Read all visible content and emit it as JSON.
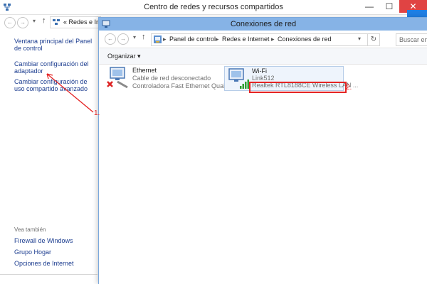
{
  "back_window": {
    "title": "Centro de redes y recursos compartidos",
    "breadcrumb": "Redes e Int",
    "controls": {
      "minimize": "—",
      "maximize": "☐",
      "close": "✕"
    }
  },
  "sidebar": {
    "links": [
      "Ventana principal del Panel de control",
      "Cambiar configuración del adaptador",
      "Cambiar configuración de uso compartido avanzado"
    ],
    "see_also_title": "Vea también",
    "see_also": [
      "Firewall de Windows",
      "Grupo Hogar",
      "Opciones de Internet"
    ]
  },
  "front_window": {
    "title": "Conexiones de red",
    "breadcrumb": [
      "Panel de control",
      "Redes e Internet",
      "Conexiones de red"
    ],
    "search_placeholder": "Buscar en Cone",
    "toolbar": {
      "organize": "Organizar"
    }
  },
  "connections": [
    {
      "name": "Ethernet",
      "status": "Cable de red desconectado",
      "device": "Controladora Fast Ethernet Qualc...",
      "icon": "ethernet-disconnected-icon"
    },
    {
      "name": "Wi-Fi",
      "status": "Link512",
      "device": "Realtek RTL8188CE Wireless LAN ...",
      "icon": "wifi-adapter-icon"
    }
  ],
  "annotations": {
    "step1": "1.",
    "step2": "2."
  },
  "colors": {
    "accent": "#1f7ee3",
    "annotation": "#e42424",
    "front_title_bar": "#86b3e6"
  }
}
